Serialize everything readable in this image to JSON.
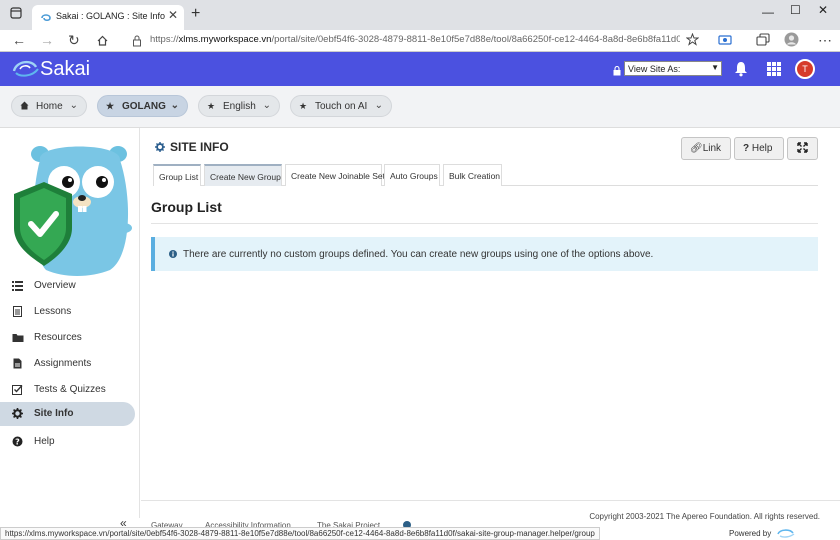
{
  "browser": {
    "tab_title": "Sakai : GOLANG : Site Info",
    "url_prefix": "https://",
    "url_host": "xlms.myworkspace.vn",
    "url_rest": "/portal/site/0ebf54f6-3028-4879-8811-8e10f5e7d88e/tool/8a66250f-ce12-4464-8a8d-8e6b8fa11d0f/...",
    "status_url": "https://xlms.myworkspace.vn/portal/site/0ebf54f6-3028-4879-8811-8e10f5e7d88e/tool/8a66250f-ce12-4464-8a8d-8e6b8fa11d0f/sakai-site-group-manager.helper/group"
  },
  "header": {
    "logo_text": "Sakai",
    "view_site_as": "View Site As:",
    "avatar_initial": "T",
    "brand_color": "#4b51e0"
  },
  "site_nav": [
    {
      "label": "Home",
      "icon": "home-icon"
    },
    {
      "label": "GOLANG",
      "icon": "star-icon"
    },
    {
      "label": "English",
      "icon": "star-icon"
    },
    {
      "label": "Touch on AI",
      "icon": "star-icon"
    }
  ],
  "tool_menu": [
    {
      "label": "Overview",
      "icon": "list-icon"
    },
    {
      "label": "Lessons",
      "icon": "document-icon"
    },
    {
      "label": "Resources",
      "icon": "folder-icon"
    },
    {
      "label": "Assignments",
      "icon": "file-icon"
    },
    {
      "label": "Tests & Quizzes",
      "icon": "checkbox-icon"
    },
    {
      "label": "Site Info",
      "icon": "gear-icon"
    },
    {
      "label": "Help",
      "icon": "question-icon"
    }
  ],
  "main": {
    "site_title": "SITE INFO",
    "link_btn": "Link",
    "help_btn": "Help",
    "tabs": [
      "Group List",
      "Create New Group",
      "Create New Joinable Set",
      "Auto Groups",
      "Bulk Creation"
    ],
    "page_heading": "Group List",
    "info_message": "There are currently no custom groups defined. You can create new groups using one of the options above."
  },
  "footer": {
    "links": [
      "Gateway",
      "Accessibility Information",
      "The Sakai Project"
    ],
    "copyright": "Copyright 2003-2021 The Apereo Foundation. All rights reserved.",
    "powered_by": "Powered by"
  }
}
